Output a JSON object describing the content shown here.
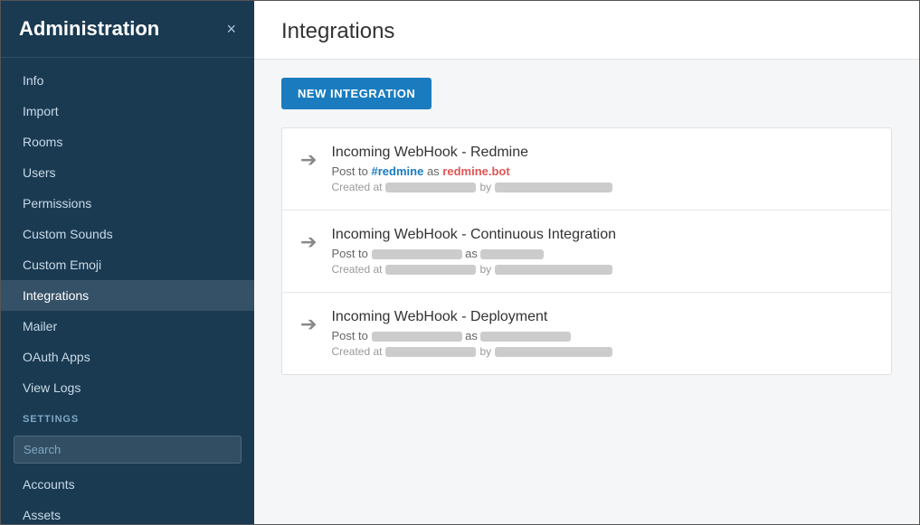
{
  "sidebar": {
    "title": "Administration",
    "close_label": "×",
    "nav_items": [
      {
        "id": "info",
        "label": "Info",
        "active": false
      },
      {
        "id": "import",
        "label": "Import",
        "active": false
      },
      {
        "id": "rooms",
        "label": "Rooms",
        "active": false
      },
      {
        "id": "users",
        "label": "Users",
        "active": false
      },
      {
        "id": "permissions",
        "label": "Permissions",
        "active": false
      },
      {
        "id": "custom-sounds",
        "label": "Custom Sounds",
        "active": false
      },
      {
        "id": "custom-emoji",
        "label": "Custom Emoji",
        "active": false
      },
      {
        "id": "integrations",
        "label": "Integrations",
        "active": true
      },
      {
        "id": "mailer",
        "label": "Mailer",
        "active": false
      },
      {
        "id": "oauth-apps",
        "label": "OAuth Apps",
        "active": false
      },
      {
        "id": "view-logs",
        "label": "View Logs",
        "active": false
      }
    ],
    "settings_label": "SETTINGS",
    "search_placeholder": "Search",
    "settings_items": [
      {
        "id": "accounts",
        "label": "Accounts"
      },
      {
        "id": "assets",
        "label": "Assets"
      }
    ]
  },
  "main": {
    "title": "Integrations",
    "new_integration_label": "NEW INTEGRATION",
    "integrations": [
      {
        "id": "redmine",
        "name": "Incoming WebHook - Redmine",
        "post_to_prefix": "Post to ",
        "channel": "#redmine",
        "as_label": " as ",
        "bot_name": "redmine.bot",
        "created_prefix": "Created at",
        "by_label": "by"
      },
      {
        "id": "ci",
        "name": "Incoming WebHook - Continuous Integration",
        "post_to_prefix": "Post to ",
        "channel": null,
        "as_label": " as ",
        "bot_name": null,
        "created_prefix": "Created at",
        "by_label": "by"
      },
      {
        "id": "deployment",
        "name": "Incoming WebHook - Deployment",
        "post_to_prefix": "Post to ",
        "channel": null,
        "as_label": " as ",
        "bot_name": null,
        "created_prefix": "Created at",
        "by_label": "by"
      }
    ]
  },
  "colors": {
    "sidebar_bg": "#1a3a52",
    "accent": "#1a7cbf"
  }
}
